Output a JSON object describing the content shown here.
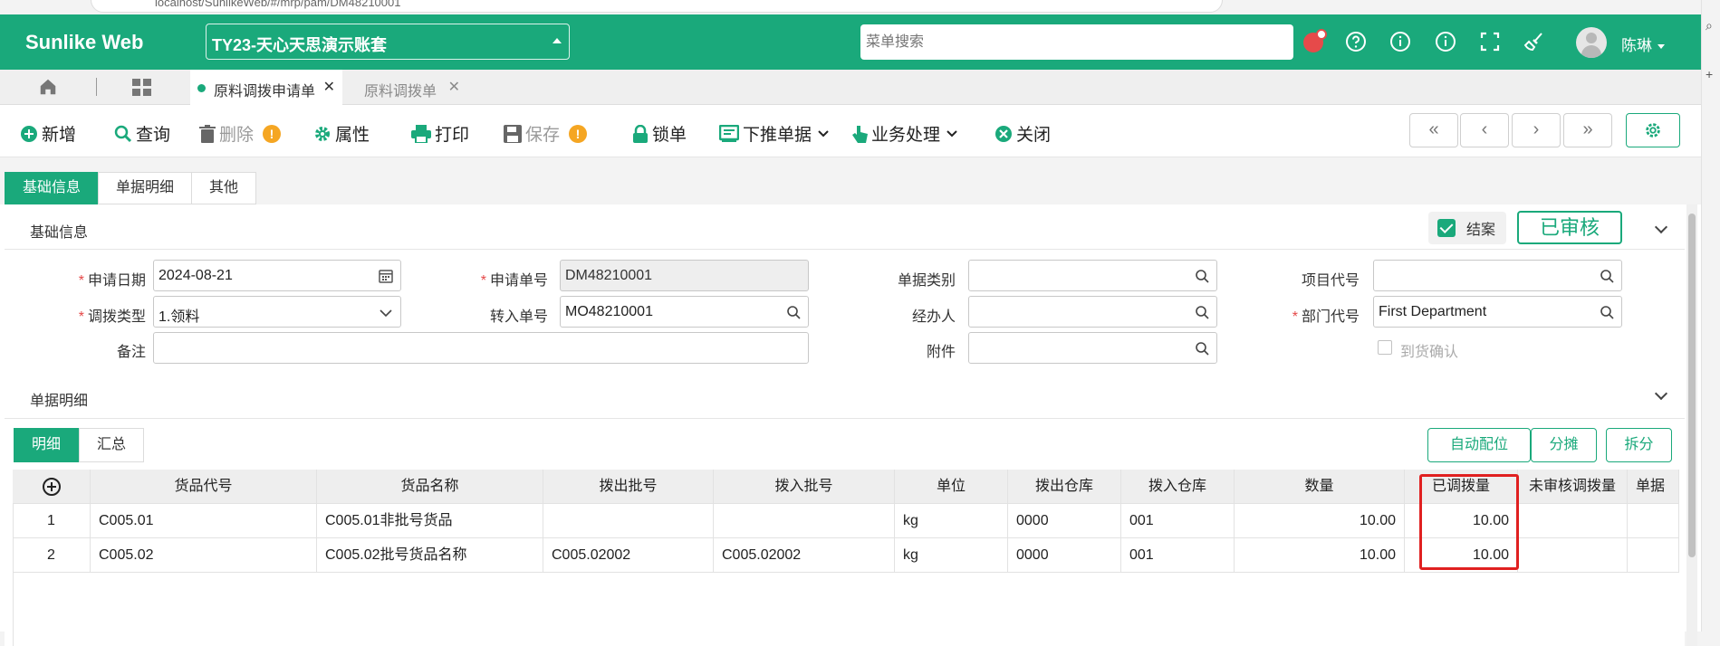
{
  "browser": {
    "url": "localhost/SunlikeWeb/#/mrp/pam/DM48210001"
  },
  "header": {
    "brand": "Sunlike Web",
    "account": "TY23-天心天思演示账套",
    "search_placeholder": "菜单搜索",
    "user": "陈琳"
  },
  "tabs": {
    "open": [
      {
        "label": "原料调拨申请单",
        "active": true
      },
      {
        "label": "原料调拨单",
        "active": false
      }
    ]
  },
  "toolbar": {
    "add": "新增",
    "query": "查询",
    "delete": "删除",
    "properties": "属性",
    "print": "打印",
    "save": "保存",
    "lock": "锁单",
    "push_down": "下推单据",
    "business": "业务处理",
    "close": "关闭",
    "warn_mark": "!"
  },
  "section_tabs": [
    "基础信息",
    "单据明细",
    "其他"
  ],
  "basic_info": {
    "title": "基础信息",
    "closed_label": "结案",
    "status": "已审核",
    "fields": {
      "apply_date_label": "申请日期",
      "apply_date": "2024-08-21",
      "apply_no_label": "申请单号",
      "apply_no": "DM48210001",
      "doc_category_label": "单据类别",
      "doc_category": "",
      "project_code_label": "项目代号",
      "project_code": "",
      "transfer_type_label": "调拨类型",
      "transfer_type": "1.领料",
      "transfer_in_no_label": "转入单号",
      "transfer_in_no": "MO48210001",
      "handler_label": "经办人",
      "handler": "",
      "dept_code_label": "部门代号",
      "dept_code": "First Department",
      "remark_label": "备注",
      "remark": "",
      "attachment_label": "附件",
      "attachment": "",
      "arrival_confirm_label": "到货确认"
    }
  },
  "details": {
    "title": "单据明细",
    "subtabs": [
      "明细",
      "汇总"
    ],
    "actions": {
      "auto_allocate": "自动配位",
      "apportion": "分摊",
      "split": "拆分"
    },
    "columns": {
      "item_code": "货品代号",
      "item_name": "货品名称",
      "out_batch": "拨出批号",
      "in_batch": "拨入批号",
      "unit": "单位",
      "out_wh": "拨出仓库",
      "in_wh": "拨入仓库",
      "qty": "数量",
      "transferred": "已调拨量",
      "unapproved": "未审核调拨量",
      "more": "单据"
    },
    "rows": [
      {
        "no": "1",
        "item_code": "C005.01",
        "item_name": "C005.01非批号货品",
        "out_batch": "",
        "in_batch": "",
        "unit": "kg",
        "out_wh": "0000",
        "in_wh": "001",
        "qty": "10.00",
        "transferred": "10.00",
        "unapproved": "",
        "more": ""
      },
      {
        "no": "2",
        "item_code": "C005.02",
        "item_name": "C005.02批号货品名称",
        "out_batch": "C005.02002",
        "in_batch": "C005.02002",
        "unit": "kg",
        "out_wh": "0000",
        "in_wh": "001",
        "qty": "10.00",
        "transferred": "10.00",
        "unapproved": "",
        "more": ""
      }
    ]
  },
  "colors": {
    "primary": "#1aa97b",
    "highlight": "#e02020",
    "warning": "#f5a623"
  }
}
